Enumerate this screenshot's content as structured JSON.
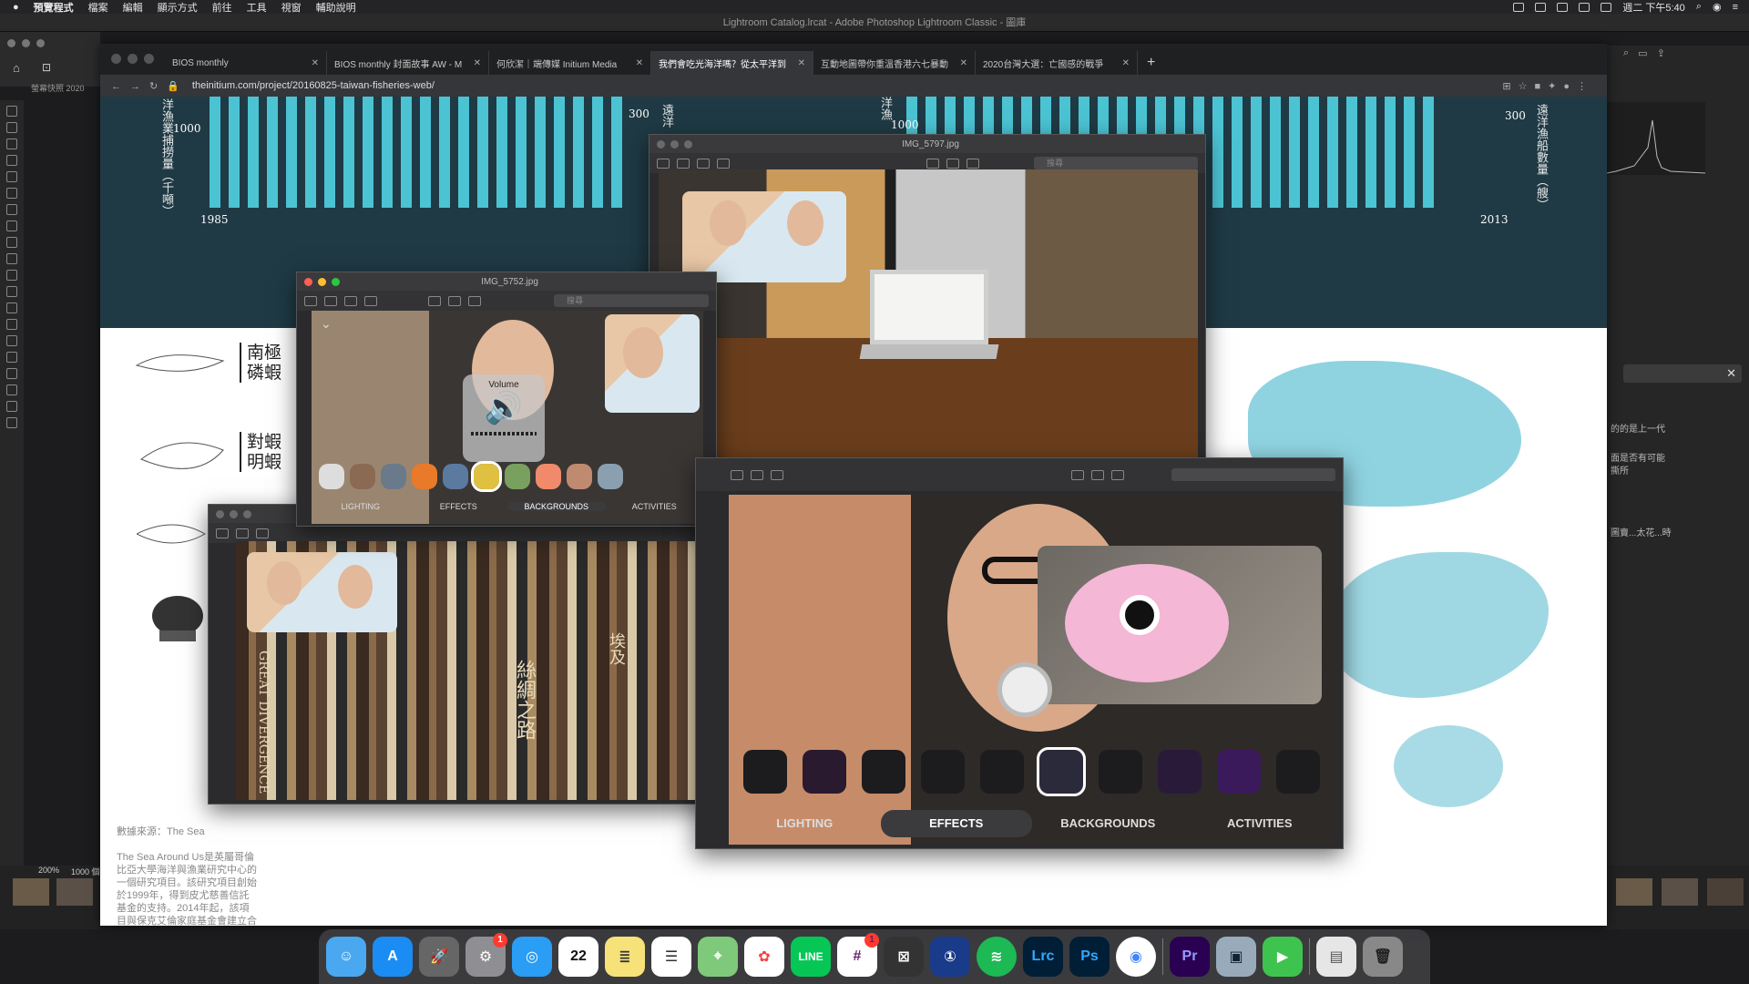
{
  "menubar": {
    "app": "預覽程式",
    "items": [
      "檔案",
      "編輯",
      "顯示方式",
      "前往",
      "工具",
      "視窗",
      "輔助說明"
    ],
    "clock": "週二 下午5:40"
  },
  "lightroom": {
    "title": "Lightroom Catalog.lrcat - Adobe Photoshop Lightroom Classic - 圖庫",
    "folder_label": "螢幕快照 2020",
    "zoom": "200%",
    "zoom_alt": "1000 個"
  },
  "browser": {
    "tabs": [
      {
        "label": "BIOS monthly",
        "active": false
      },
      {
        "label": "BIOS monthly 封面故事 AW - M",
        "active": false
      },
      {
        "label": "何欣潔｜端傳媒 Initium Media",
        "active": false
      },
      {
        "label": "我們會吃光海洋嗎？從太平洋到",
        "active": true
      },
      {
        "label": "互動地圖帶你重溫香港六七暴動",
        "active": false
      },
      {
        "label": "2020台灣大選：亡國感的戰爭",
        "active": false
      }
    ],
    "url": "theinitium.com/project/20160825-taiwan-fisheries-web/"
  },
  "chart": {
    "left_label": "洋漁業捕撈量（千噸）",
    "left_tick": "1000",
    "left_start": "1985",
    "mid_tick": "300",
    "mid_label": "遠洋",
    "mid_label2": "洋漁",
    "mid_tick2": "1000",
    "right_end": "2013",
    "right_tick": "300",
    "right_label": "遠洋漁船數量（艘）"
  },
  "species": [
    {
      "name1": "南極",
      "name2": "磷蝦"
    },
    {
      "name1": "對蝦",
      "name2": "明蝦"
    }
  ],
  "source": {
    "title": "數據來源：The Sea",
    "body": "The Sea Around Us是英屬哥倫比亞大學海洋與漁業研究中心的一個研究項目。該研究項目創始於1999年，得到皮尤慈善信託基金的支持。2014年起，該項目與保克艾倫家庭基金會建立合作，開始向非洲和亞洲國家，提供更多準確和全面的漁業數據。"
  },
  "side_text": {
    "line1": "的的是上一代",
    "line2": "面是否有可能",
    "line3": "撕所",
    "line4": "圖賣...太花...時"
  },
  "windows": {
    "img5797": {
      "title": "IMG_5797.jpg",
      "search": "搜尋"
    },
    "img5752": {
      "title": "IMG_5752.jpg",
      "search": "搜尋"
    },
    "volume": "Volume",
    "small_tabs": [
      "LIGHTING",
      "EFFECTS",
      "BACKGROUNDS",
      "ACTIVITIES"
    ],
    "small_selected": "BACKGROUNDS",
    "large_tabs": [
      "LIGHTING",
      "EFFECTS",
      "BACKGROUNDS",
      "ACTIVITIES"
    ],
    "large_selected": "EFFECTS",
    "books": [
      "GREAT DIVERGENCE",
      "絲綢之路",
      "埃及"
    ]
  },
  "dock": {
    "apps": [
      "finder",
      "app-store",
      "launchpad",
      "system-preferences",
      "safari",
      "calendar",
      "notes",
      "reminders",
      "maps",
      "photos",
      "line",
      "slack",
      "capture",
      "1password",
      "spotify",
      "lightroom-classic",
      "photoshop",
      "chrome",
      "premiere",
      "preview",
      "facetime",
      "document",
      "trash"
    ],
    "calendar_day": "22",
    "labels": {
      "lrc": "Lrc",
      "ps": "Ps",
      "pr": "Pr",
      "line": "LINE"
    },
    "badges": {
      "system-preferences": "1",
      "slack": "1"
    }
  }
}
